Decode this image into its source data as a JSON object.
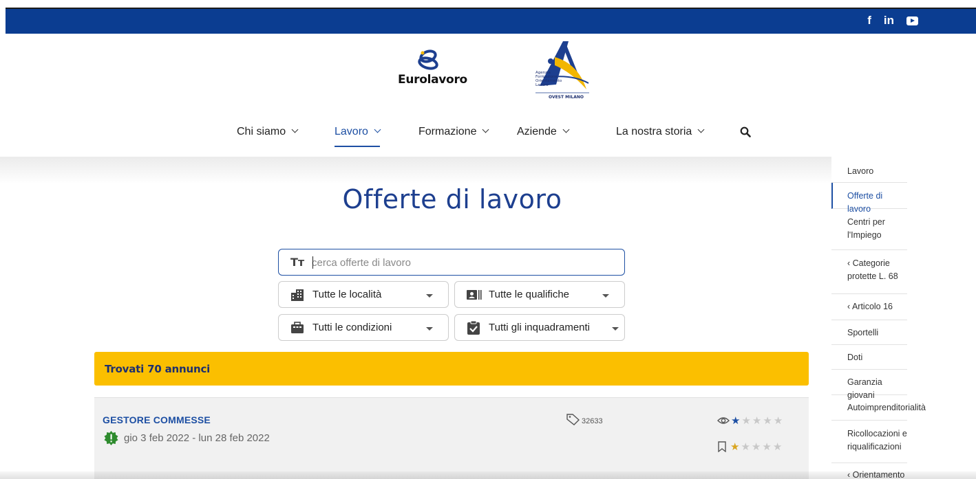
{
  "social": {
    "facebook": "f",
    "linkedin": "in",
    "youtube_icon": "youtube-icon"
  },
  "logos": {
    "eurolavoro": "Eurolavoro",
    "afol_lines": [
      "Agenzia",
      "Formazione",
      "Orientamento",
      "Lavoro"
    ],
    "afol_sub": "OVEST MILANO"
  },
  "nav": {
    "items": [
      {
        "label": "Chi siamo"
      },
      {
        "label": "Lavoro"
      },
      {
        "label": "Formazione"
      },
      {
        "label": "Aziende"
      },
      {
        "label": "La nostra storia"
      }
    ],
    "active_index": 1
  },
  "sidebar": {
    "items": [
      {
        "label": "Lavoro"
      },
      {
        "label": "Offerte di lavoro"
      },
      {
        "label": "Centri per l'Impiego"
      },
      {
        "label": "‹ Categorie protette L. 68"
      },
      {
        "label": "‹ Articolo 16"
      },
      {
        "label": "Sportelli"
      },
      {
        "label": "Doti"
      },
      {
        "label": "Garanzia giovani"
      },
      {
        "label": "Autoimprenditorialità"
      },
      {
        "label": "Ricollocazioni e riqualificazioni"
      },
      {
        "label": "‹ Orientamento"
      }
    ],
    "active_index": 1
  },
  "page": {
    "title": "Offerte di lavoro"
  },
  "search": {
    "placeholder": "cerca offerte di lavoro",
    "value": "",
    "icon_text": "Tт"
  },
  "filters": {
    "location": "Tutte le località",
    "qualification": "Tutte le qualifiche",
    "conditions": "Tutti le condizioni",
    "classification": "Tutti gli inquadramenti"
  },
  "results": {
    "text": "Trovati 70 annunci"
  },
  "jobs": [
    {
      "title": "GESTORE COMMESSE",
      "dates": "gio 3 feb 2022 - lun 28 feb 2022",
      "tag_number": "32633",
      "views_rating": 1,
      "saved_rating": 1
    }
  ],
  "colors": {
    "topbar": "#0b3d91",
    "accent": "#1d4fa3",
    "results_bar": "#fbbf00",
    "new_badge": "#2e8b2e"
  }
}
